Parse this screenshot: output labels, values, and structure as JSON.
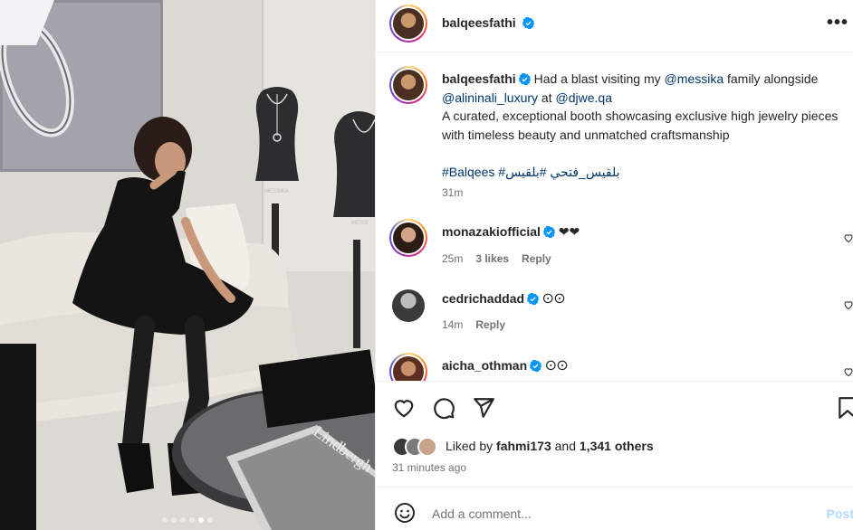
{
  "post": {
    "username": "balqeesfathi",
    "more_label": "•••",
    "carousel_count": 6,
    "carousel_active_index": 4
  },
  "caption": {
    "username": "balqeesfathi",
    "text_1": "Had a blast visiting my ",
    "mention_1": "@messika",
    "text_2": " family alongside ",
    "mention_2": "@alininali_luxury",
    "text_3": " at ",
    "mention_3": "@djwe.qa",
    "text_4": "A curated, exceptional booth showcasing exclusive high jewelry pieces with timeless beauty and unmatched craftsmanship",
    "hashtags": "#Balqees #بلقيس_فتحي #بلقيس",
    "time": "31m"
  },
  "comments": [
    {
      "username": "monazakiofficial",
      "text": "❤❤",
      "time": "25m",
      "likes": "3 likes",
      "reply": "Reply"
    },
    {
      "username": "cedrichaddad",
      "text": "𐌏𐌏",
      "time": "14m",
      "reply": "Reply"
    },
    {
      "username": "aicha_othman",
      "text": "𐌏𐌏"
    }
  ],
  "likes": {
    "prefix": "Liked by ",
    "first_user": "fahmi173",
    "mid": " and ",
    "others": "1,341 others",
    "time_ago": "31 minutes ago"
  },
  "add_comment": {
    "placeholder": "Add a comment...",
    "post_label": "Post"
  },
  "photo_text": {
    "brand_1": "MESSIKA",
    "brand_2": "MESSI",
    "book": "Lindbergh"
  },
  "colors": {
    "link": "#00376b",
    "verified": "#0095f6",
    "muted": "#737373",
    "post_disabled": "#b3dbff"
  }
}
